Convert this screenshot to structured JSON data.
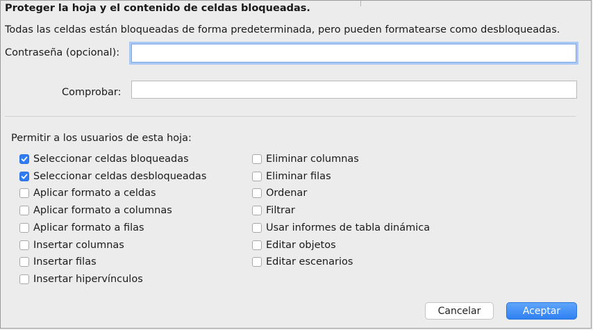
{
  "dialog": {
    "title": "Proteger la hoja y el contenido de celdas bloqueadas.",
    "description": "Todas las celdas están bloqueadas de forma predeterminada, pero pueden formatearse como desbloqueadas."
  },
  "password": {
    "label": "Contraseña (opcional):",
    "value": ""
  },
  "verify": {
    "label": "Comprobar:",
    "value": ""
  },
  "permissions": {
    "heading": "Permitir a los usuarios de esta hoja:",
    "left": [
      {
        "label": "Seleccionar celdas bloqueadas",
        "checked": true
      },
      {
        "label": "Seleccionar celdas desbloqueadas",
        "checked": true
      },
      {
        "label": "Aplicar formato a celdas",
        "checked": false
      },
      {
        "label": "Aplicar formato a columnas",
        "checked": false
      },
      {
        "label": "Aplicar formato a filas",
        "checked": false
      },
      {
        "label": "Insertar columnas",
        "checked": false
      },
      {
        "label": "Insertar filas",
        "checked": false
      },
      {
        "label": "Insertar hipervínculos",
        "checked": false
      }
    ],
    "right": [
      {
        "label": "Eliminar columnas",
        "checked": false
      },
      {
        "label": "Eliminar filas",
        "checked": false
      },
      {
        "label": "Ordenar",
        "checked": false
      },
      {
        "label": "Filtrar",
        "checked": false
      },
      {
        "label": "Usar informes de tabla dinámica",
        "checked": false
      },
      {
        "label": "Editar objetos",
        "checked": false
      },
      {
        "label": "Editar escenarios",
        "checked": false
      }
    ]
  },
  "buttons": {
    "cancel": "Cancelar",
    "ok": "Aceptar"
  },
  "colors": {
    "accent": "#2f7cf6",
    "background": "#ececec"
  }
}
